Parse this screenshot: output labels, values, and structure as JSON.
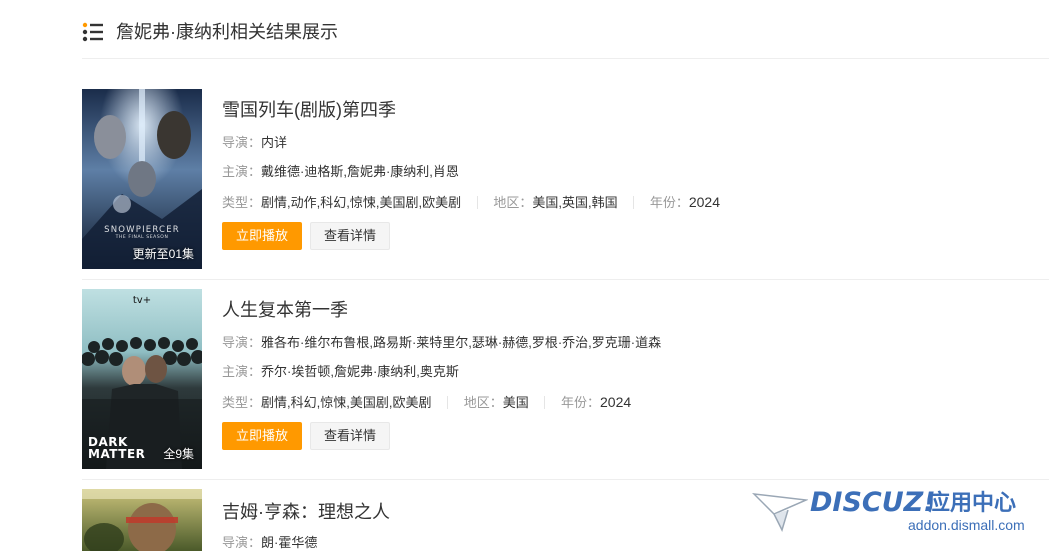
{
  "header": {
    "icon": "list-icon",
    "title": "詹妮弗·康纳利相关结果展示"
  },
  "labels": {
    "director": "导演：",
    "cast": "主演：",
    "genre": "类型：",
    "region": "地区：",
    "year": "年份："
  },
  "buttons": {
    "play": "立即播放",
    "detail": "查看详情"
  },
  "results": [
    {
      "title": "雪国列车(剧版)第四季",
      "director": "内详",
      "cast": "戴维德·迪格斯,詹妮弗·康纳利,肖恩",
      "genre": "剧情,动作,科幻,惊悚,美国剧,欧美剧",
      "region": "美国,英国,韩国",
      "year": "2024",
      "badge": "更新至01集",
      "poster_text": "SNOWPIERCER",
      "poster_subtext": "THE FINAL SEASON"
    },
    {
      "title": "人生复本第一季",
      "director": "雅各布·维尔布鲁根,路易斯·莱特里尔,瑟琳·赫德,罗根·乔治,罗克珊·道森",
      "cast": "乔尔·埃哲顿,詹妮弗·康纳利,奥克斯",
      "genre": "剧情,科幻,惊悚,美国剧,欧美剧",
      "region": "美国",
      "year": "2024",
      "badge": "全9集",
      "poster_logo": "tv+",
      "poster_text": "DARK MATTER"
    },
    {
      "title": "吉姆·亨森：理想之人",
      "director": "朗·霍华德"
    }
  ],
  "watermark": {
    "brand": "DISCUZ!",
    "cn": "应用中心",
    "url": "addon.dismall.com"
  },
  "colors": {
    "accent": "#ff9900",
    "label": "#999999",
    "text": "#333333",
    "divider": "#eeeeee",
    "watermark": "#3c6fb8"
  }
}
